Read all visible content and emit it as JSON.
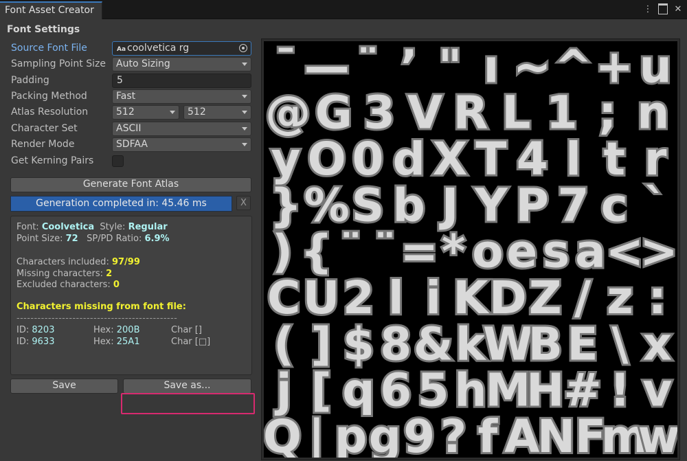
{
  "window": {
    "tab_title": "Font Asset Creator",
    "icons": [
      "more-options-icon",
      "maximize-icon",
      "close-icon"
    ]
  },
  "settings": {
    "section_title": "Font Settings",
    "source_font_file": {
      "label": "Source Font File",
      "value": "coolvetica rg",
      "icon": "font-file-icon"
    },
    "sampling_point_size": {
      "label": "Sampling Point Size",
      "value": "Auto Sizing"
    },
    "padding": {
      "label": "Padding",
      "value": "5"
    },
    "packing_method": {
      "label": "Packing Method",
      "value": "Fast"
    },
    "atlas_resolution": {
      "label": "Atlas Resolution",
      "width": "512",
      "height": "512"
    },
    "character_set": {
      "label": "Character Set",
      "value": "ASCII"
    },
    "render_mode": {
      "label": "Render Mode",
      "value": "SDFAA"
    },
    "get_kerning_pairs": {
      "label": "Get Kerning Pairs",
      "checked": false
    }
  },
  "actions": {
    "generate_label": "Generate Font Atlas",
    "progress_text": "Generation completed in: 45.46 ms",
    "progress_value": 1.0,
    "close_label": "X",
    "save_label": "Save",
    "save_as_label": "Save as..."
  },
  "info": {
    "font_label": "Font:",
    "font_value": "Coolvetica",
    "style_label": "Style:",
    "style_value": "Regular",
    "point_size_label": "Point Size:",
    "point_size_value": "72",
    "ratio_label": "SP/PD Ratio:",
    "ratio_value": "6.9%",
    "included_label": "Characters included:",
    "included_value": "97/99",
    "missing_label": "Missing characters:",
    "missing_value": "2",
    "excluded_label": "Excluded characters:",
    "excluded_value": "0",
    "missing_header": "Characters missing from font file:",
    "divider": "----------------------------------------------",
    "missing_rows": [
      {
        "id_label": "ID:",
        "id": "8203",
        "hex_label": "Hex:",
        "hex": "200B",
        "char_label": "Char",
        "char": "[]"
      },
      {
        "id_label": "ID:",
        "id": "9633",
        "hex_label": "Hex:",
        "hex": "25A1",
        "char_label": "Char",
        "char": "[□]"
      }
    ]
  },
  "atlas": {
    "rows": [
      [
        "¯",
        "—",
        "¨",
        "ʼ",
        "\"",
        "ı",
        "~",
        "^",
        "+",
        "u"
      ],
      [
        "@",
        "G",
        "3",
        "V",
        "R",
        "L",
        "1",
        ";",
        "n"
      ],
      [
        "y",
        "O",
        "0",
        "d",
        "X",
        "T",
        "4",
        "l",
        "t",
        "r"
      ],
      [
        "}",
        "%",
        "S",
        "b",
        "J",
        "Y",
        "P",
        "7",
        "c",
        "`"
      ],
      [
        ")",
        "{",
        "¨",
        "¨",
        "=",
        "*",
        "o",
        "e",
        "s",
        "a",
        "<",
        ">"
      ],
      [
        "C",
        "U",
        "2",
        "l",
        "i",
        "K",
        "D",
        "Z",
        "/",
        "z",
        ":"
      ],
      [
        "(",
        "]",
        "$",
        "8",
        "&",
        "k",
        "W",
        "B",
        "E",
        "\\",
        "x"
      ],
      [
        "j",
        "[",
        "q",
        "6",
        "5",
        "h",
        "M",
        "H",
        "#",
        "!",
        "v"
      ],
      [
        "Q",
        "|",
        "p",
        "g",
        "9",
        "?",
        "f",
        "A",
        "N",
        "F",
        "m",
        "w"
      ]
    ]
  }
}
